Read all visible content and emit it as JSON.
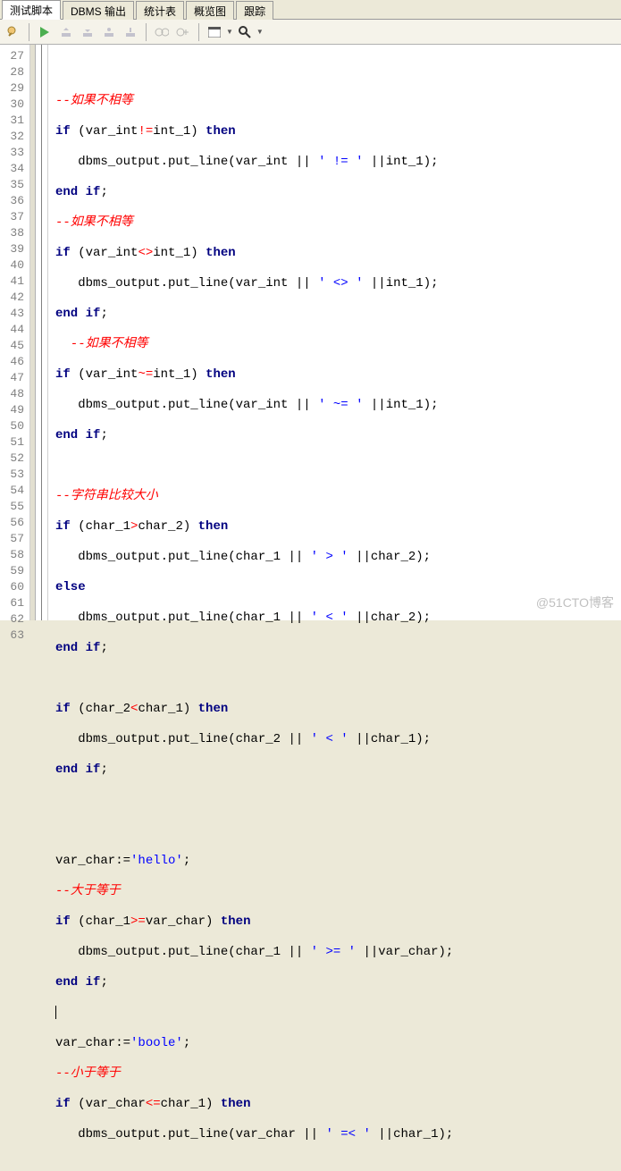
{
  "tabs": {
    "t0": "测试脚本",
    "t1": "DBMS 输出",
    "t2": "统计表",
    "t3": "概览图",
    "t4": "跟踪"
  },
  "watermark": "@51CTO博客",
  "gutter": {
    "start": 27,
    "end": 63
  },
  "code": {
    "l27": "",
    "l28c": "--如果不相等",
    "l29a": "if",
    "l29b": " (var_int",
    "l29c": "!=",
    "l29d": "int_1) ",
    "l29e": "then",
    "l30a": "   dbms_output.put_line(var_int || ",
    "l30b": "' != '",
    "l30c": " ||int_1);",
    "l31a": "end",
    "l31b": " ",
    "l31c": "if",
    "l31d": ";",
    "l32c": "--如果不相等",
    "l33a": "if",
    "l33b": " (var_int",
    "l33c": "<>",
    "l33d": "int_1) ",
    "l33e": "then",
    "l34a": "   dbms_output.put_line(var_int || ",
    "l34b": "' <> '",
    "l34c": " ||int_1);",
    "l35a": "end",
    "l35b": " ",
    "l35c": "if",
    "l35d": ";",
    "l36c": "  --如果不相等",
    "l37a": "if",
    "l37b": " (var_int",
    "l37c": "~=",
    "l37d": "int_1) ",
    "l37e": "then",
    "l38a": "   dbms_output.put_line(var_int || ",
    "l38b": "' ~= '",
    "l38c": " ||int_1);",
    "l39a": "end",
    "l39b": " ",
    "l39c": "if",
    "l39d": ";",
    "l40": "",
    "l41c": "--字符串比较大小",
    "l42a": "if",
    "l42b": " (char_1",
    "l42c": ">",
    "l42d": "char_2) ",
    "l42e": "then",
    "l43a": "   dbms_output.put_line(char_1 || ",
    "l43b": "' > '",
    "l43c": " ||char_2);",
    "l44a": "else",
    "l45a": "   dbms_output.put_line(char_1 || ",
    "l45b": "' < '",
    "l45c": " ||char_2);",
    "l46a": "end",
    "l46b": " ",
    "l46c": "if",
    "l46d": ";",
    "l47": "",
    "l48a": "if",
    "l48b": " (char_2",
    "l48c": "<",
    "l48d": "char_1) ",
    "l48e": "then",
    "l49a": "   dbms_output.put_line(char_2 || ",
    "l49b": "' < '",
    "l49c": " ||char_1);",
    "l50a": "end",
    "l50b": " ",
    "l50c": "if",
    "l50d": ";",
    "l51": "",
    "l52": "",
    "l53a": "var_char:=",
    "l53b": "'hello'",
    "l53c": ";",
    "l54c": "--大于等于",
    "l55a": "if",
    "l55b": " (char_1",
    "l55c": ">=",
    "l55d": "var_char) ",
    "l55e": "then",
    "l56a": "   dbms_output.put_line(char_1 || ",
    "l56b": "' >= '",
    "l56c": " ||var_char);",
    "l57a": "end",
    "l57b": " ",
    "l57c": "if",
    "l57d": ";",
    "l58": "",
    "l59a": "var_char:=",
    "l59b": "'boole'",
    "l59c": ";",
    "l60c": "--小于等于",
    "l61a": "if",
    "l61b": " (var_char",
    "l61c": "<=",
    "l61d": "char_1) ",
    "l61e": "then",
    "l62a": "   dbms_output.put_line(var_char || ",
    "l62b": "' =< '",
    "l62c": " ||char_1);"
  }
}
